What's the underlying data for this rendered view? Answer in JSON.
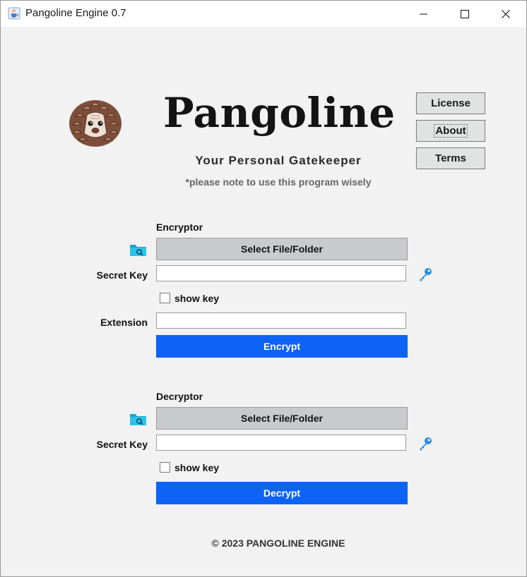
{
  "window": {
    "title": "Pangoline Engine 0.7",
    "icons": [
      "java-cup-icon",
      "minimize-icon",
      "maximize-icon",
      "close-icon"
    ]
  },
  "header": {
    "brand": "Pangoline",
    "tagline": "Your Personal Gatekeeper",
    "note": "*please note to use this program wisely",
    "logo_icon": "pangolin-mascot-icon"
  },
  "side_buttons": {
    "license": "License",
    "about": "About",
    "terms": "Terms"
  },
  "encryptor": {
    "title": "Encryptor",
    "select_label": "Select File/Folder",
    "secret_key_label": "Secret Key",
    "secret_key_value": "",
    "show_key_label": "show key",
    "show_key_checked": false,
    "extension_label": "Extension",
    "extension_value": "",
    "action_label": "Encrypt"
  },
  "decryptor": {
    "title": "Decryptor",
    "select_label": "Select File/Folder",
    "secret_key_label": "Secret Key",
    "secret_key_value": "",
    "show_key_label": "show key",
    "show_key_checked": false,
    "action_label": "Decrypt"
  },
  "footer": {
    "text": "© 2023 PANGOLINE ENGINE"
  },
  "colors": {
    "accent": "#0d63f6",
    "background": "#f2f2f2",
    "select_button": "#c8cacb",
    "side_button": "#e1e3e3"
  }
}
